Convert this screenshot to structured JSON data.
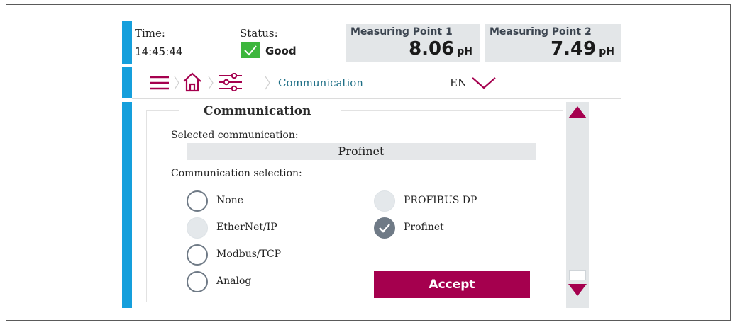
{
  "header": {
    "time_label": "Time:",
    "time_value": "14:45:44",
    "status_label": "Status:",
    "status_value": "Good",
    "status_color": "#3db63d",
    "measuring_points": [
      {
        "name": "Measuring Point 1",
        "value": "8.06",
        "unit": "pH"
      },
      {
        "name": "Measuring Point 2",
        "value": "7.49",
        "unit": "pH"
      }
    ]
  },
  "nav": {
    "menu_icon": "hamburger-menu-icon",
    "home_icon": "home-icon",
    "settings_icon": "settings-sliders-icon",
    "breadcrumb": "Communication",
    "language": "EN",
    "language_icon": "chevron-down-icon"
  },
  "content": {
    "title": "Communication",
    "selected_label": "Selected communication:",
    "selected_value": "Profinet",
    "selection_label": "Communication selection:",
    "options": [
      {
        "label": "None",
        "state": "unchecked"
      },
      {
        "label": "EtherNet/IP",
        "state": "disabled"
      },
      {
        "label": "Modbus/TCP",
        "state": "unchecked"
      },
      {
        "label": "Analog",
        "state": "unchecked"
      },
      {
        "label": "PROFIBUS DP",
        "state": "disabled"
      },
      {
        "label": "Profinet",
        "state": "checked"
      }
    ],
    "accept_label": "Accept"
  },
  "colors": {
    "accent": "#a5004e",
    "side_bar": "#159fdc",
    "radio": "#6f7a86"
  },
  "scrollbar": {
    "up_icon": "triangle-up-icon",
    "down_icon": "triangle-down-icon"
  }
}
